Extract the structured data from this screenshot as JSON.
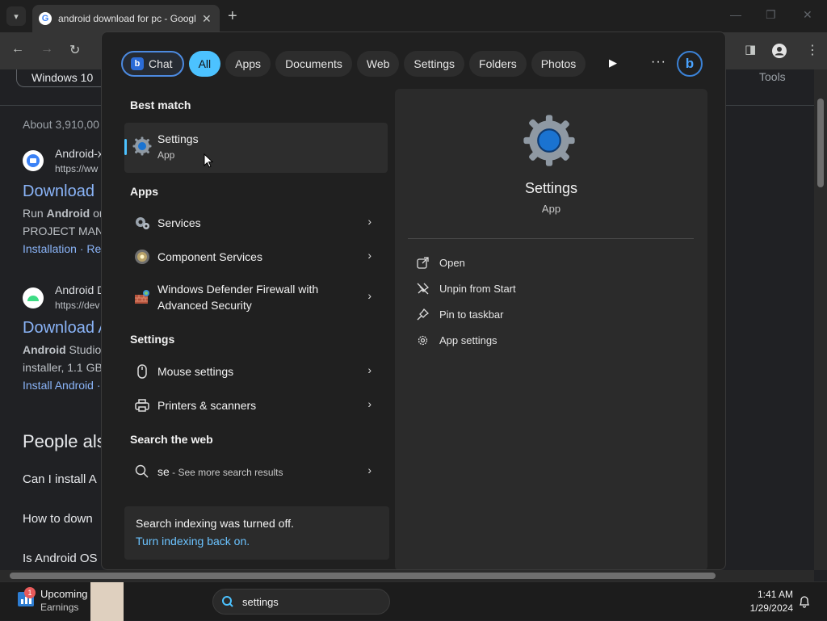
{
  "browser": {
    "tab_title": "android download for pc - Google",
    "tools_label": "Tools",
    "chip_label": "Windows 10"
  },
  "results": {
    "about": "About 3,910,00",
    "r1_site": "Android-x",
    "r1_url": "https://ww",
    "r1_title": "Download",
    "r1_body1_bold": "Android",
    "r1_body1_rest": " on",
    "r1_body2": "PROJECT MANA",
    "r1_sub": "Installation · Re",
    "r2_site": "Android D",
    "r2_url": "https://dev",
    "r2_title": "Download A",
    "r2_body1_bold": "Android",
    "r2_body1_rest": " Studio",
    "r2_body2": "installer, 1.1 GB",
    "r2_sub": "Install Android ·",
    "paa_heading": "People als",
    "q1": "Can I install A",
    "q2": "How to down",
    "q3": "Is Android OS"
  },
  "results_run": "Run ",
  "flyout": {
    "pills": [
      {
        "label": "Chat"
      },
      {
        "label": "All"
      },
      {
        "label": "Apps"
      },
      {
        "label": "Documents"
      },
      {
        "label": "Web"
      },
      {
        "label": "Settings"
      },
      {
        "label": "Folders"
      },
      {
        "label": "Photos"
      }
    ],
    "best_match_heading": "Best match",
    "best_match": {
      "title": "Settings",
      "kind": "App"
    },
    "apps_heading": "Apps",
    "apps": [
      {
        "label": "Services"
      },
      {
        "label": "Component Services"
      },
      {
        "label_line1": "Windows Defender Firewall with",
        "label_line2": "Advanced Security"
      }
    ],
    "settings_heading": "Settings",
    "settings_items": [
      {
        "label": "Mouse settings"
      },
      {
        "label": "Printers & scanners"
      }
    ],
    "web_heading": "Search the web",
    "web_query": "se",
    "web_hint": " - See more search results",
    "index_notice": "Search indexing was turned off.",
    "index_link": "Turn indexing back on.",
    "preview": {
      "name": "Settings",
      "kind": "App",
      "actions": [
        {
          "label": "Open",
          "icon": "open-external-icon"
        },
        {
          "label": "Unpin from Start",
          "icon": "unpin-icon"
        },
        {
          "label": "Pin to taskbar",
          "icon": "pin-icon"
        },
        {
          "label": "App settings",
          "icon": "gear-icon"
        }
      ]
    }
  },
  "taskbar": {
    "widget_badge": "1",
    "widget_title": "Upcoming",
    "widget_sub": "Earnings",
    "search_text": "settings",
    "time": "1:41 AM",
    "date": "1/29/2024"
  },
  "colors": {
    "accent": "#4cc2ff",
    "link": "#8ab4f8",
    "flyout_bg": "#202020"
  }
}
